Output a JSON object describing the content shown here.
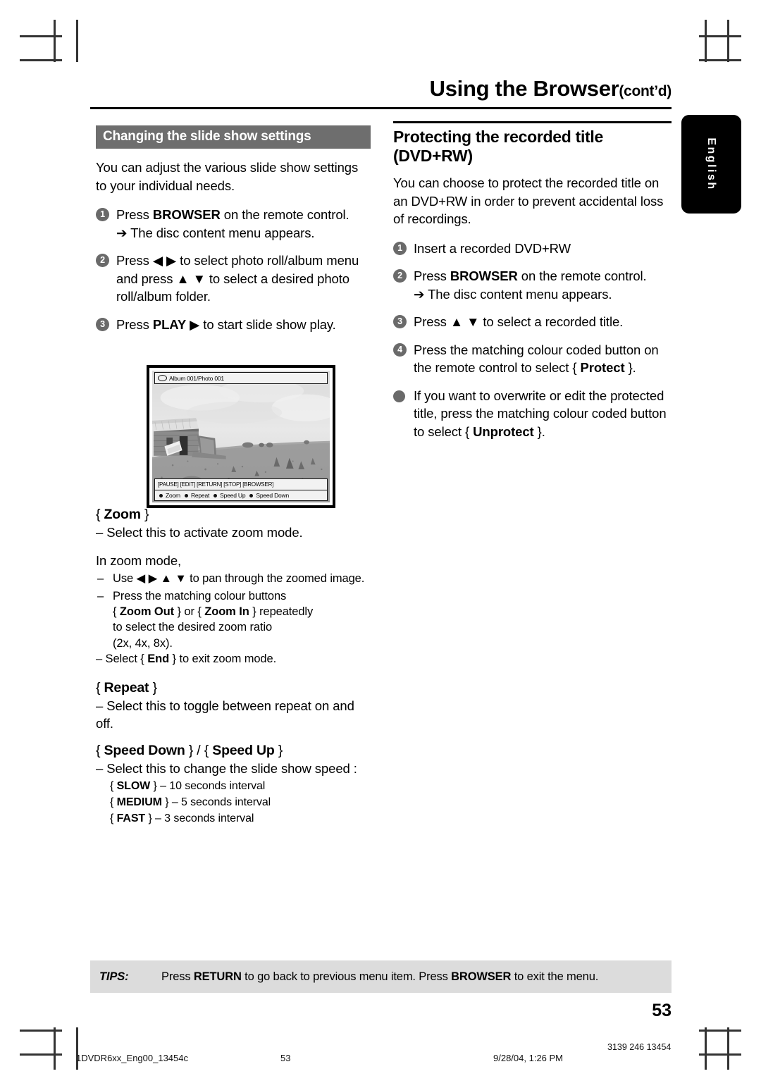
{
  "header": {
    "title_main": "Using the Browser",
    "title_contd": "(cont’d)",
    "language_tab": "English"
  },
  "left_column": {
    "section_banner": "Changing the slide show settings",
    "intro": "You can adjust the various slide show settings to your individual needs.",
    "steps": [
      {
        "num": "1",
        "text": "Press BROWSER on the remote control.",
        "text_plain": "Press ",
        "bold": "BROWSER",
        "text_tail": " on the remote control.",
        "arrow": "➔ The disc content menu appears."
      },
      {
        "num": "2",
        "text": "Press ◀ ▶ to select photo roll/album menu and press ▲ ▼ to select a desired photo roll/album folder."
      },
      {
        "num": "3",
        "text_plain": "Press ",
        "bold": "PLAY",
        "text_tail": " ▶  to start slide show play."
      }
    ],
    "options": [
      {
        "heading_open": "{ ",
        "heading_bold": "Zoom",
        "heading_close": " }",
        "lines": [
          "–  Select this to activate zoom mode."
        ]
      }
    ],
    "zoom_mode_label": "In zoom mode,",
    "zoom_mode_items": [
      "Use ◀ ▶  ▲  ▼ to pan through the zoomed image.",
      "Press the matching colour buttons",
      "Select { End } to exit zoom mode."
    ],
    "zoom_detail": {
      "line_a_pre": "{ ",
      "line_a_b1": "Zoom Out",
      "line_a_mid": " } or { ",
      "line_a_b2": "Zoom In",
      "line_a_post": " } repeatedly",
      "line_b": "to select the desired zoom ratio",
      "line_c": "(2x, 4x, 8x).",
      "end_pre": "–  Select { ",
      "end_bold": "End",
      "end_post": " } to exit zoom mode."
    },
    "repeat": {
      "heading_bold": "Repeat",
      "line": "–  Select this to toggle between repeat on and off."
    },
    "speed": {
      "heading_bold_1": "Speed Down",
      "heading_sep": " } / { ",
      "heading_bold_2": "Speed Up",
      "line": "–  Select this to change the slide show speed :",
      "intervals": [
        {
          "bold": "SLOW",
          "text": " } – 10 seconds interval"
        },
        {
          "bold": "MEDIUM",
          "text": " } – 5 seconds interval"
        },
        {
          "bold": "FAST",
          "text": " } – 3 seconds interval"
        }
      ]
    }
  },
  "right_column": {
    "heading_line1": "Protecting the recorded title",
    "heading_line2": "(DVD+RW)",
    "intro": "You can choose to protect the recorded title on an DVD+RW in order to prevent accidental loss of recordings.",
    "steps": [
      {
        "num": "1",
        "text": "Insert a recorded DVD+RW"
      },
      {
        "num": "2",
        "pre": "Press ",
        "bold": "BROWSER",
        "post": " on the remote control.",
        "arrow": "➔ The disc content menu appears."
      },
      {
        "num": "3",
        "text": "Press ▲ ▼ to select a recorded title."
      },
      {
        "num": "4",
        "pre": "Press the matching colour coded button on the remote control to select { ",
        "bold": "Protect",
        "post": " }."
      },
      {
        "num": "●",
        "pre": "If you want to overwrite or edit the protected title, press the matching colour coded button to select { ",
        "bold": "Unprotect",
        "post": " }."
      }
    ]
  },
  "tv_screenshot": {
    "title_bar": "Album 001/Photo 001",
    "disc_icon": "disc-icon",
    "button_hints": "[PAUSE] [EDIT] [RETURN] [STOP] [BROWSER]",
    "colour_buttons": [
      "Zoom",
      "Repeat",
      "Speed Up",
      "Speed Down"
    ]
  },
  "tips": {
    "label": "TIPS:",
    "pre": "Press ",
    "bold1": "RETURN",
    "mid": " to go back to previous menu item.  Press ",
    "bold2": "BROWSER",
    "post": " to exit the menu."
  },
  "page_number": "53",
  "print_footer": {
    "file": "1DVDR6xx_Eng00_13454c",
    "page": "53",
    "date": "9/28/04, 1:26 PM",
    "code": "3139 246 13454"
  },
  "colors": {
    "banner_grey": "#6e6e6e",
    "badge_grey": "#6a6a6a",
    "tips_grey": "#dcdcdc",
    "tab_black": "#000000"
  }
}
